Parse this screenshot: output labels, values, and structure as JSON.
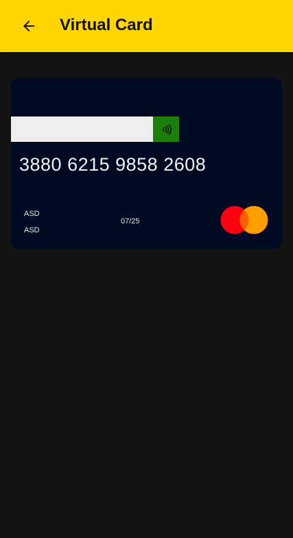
{
  "header": {
    "title": "Virtual Card",
    "back_icon": "arrow-left-icon",
    "background_color": "#FFD600"
  },
  "card": {
    "number": "3880 6215 9858 2608",
    "holder_line_1": "ASD",
    "holder_line_2": "ASD",
    "expiry": "07/25",
    "contactless_icon": "contactless-icon",
    "brand_icon": "mastercard-logo-icon",
    "background_color": "#000A22",
    "contactless_color": "#1E7E0B"
  }
}
